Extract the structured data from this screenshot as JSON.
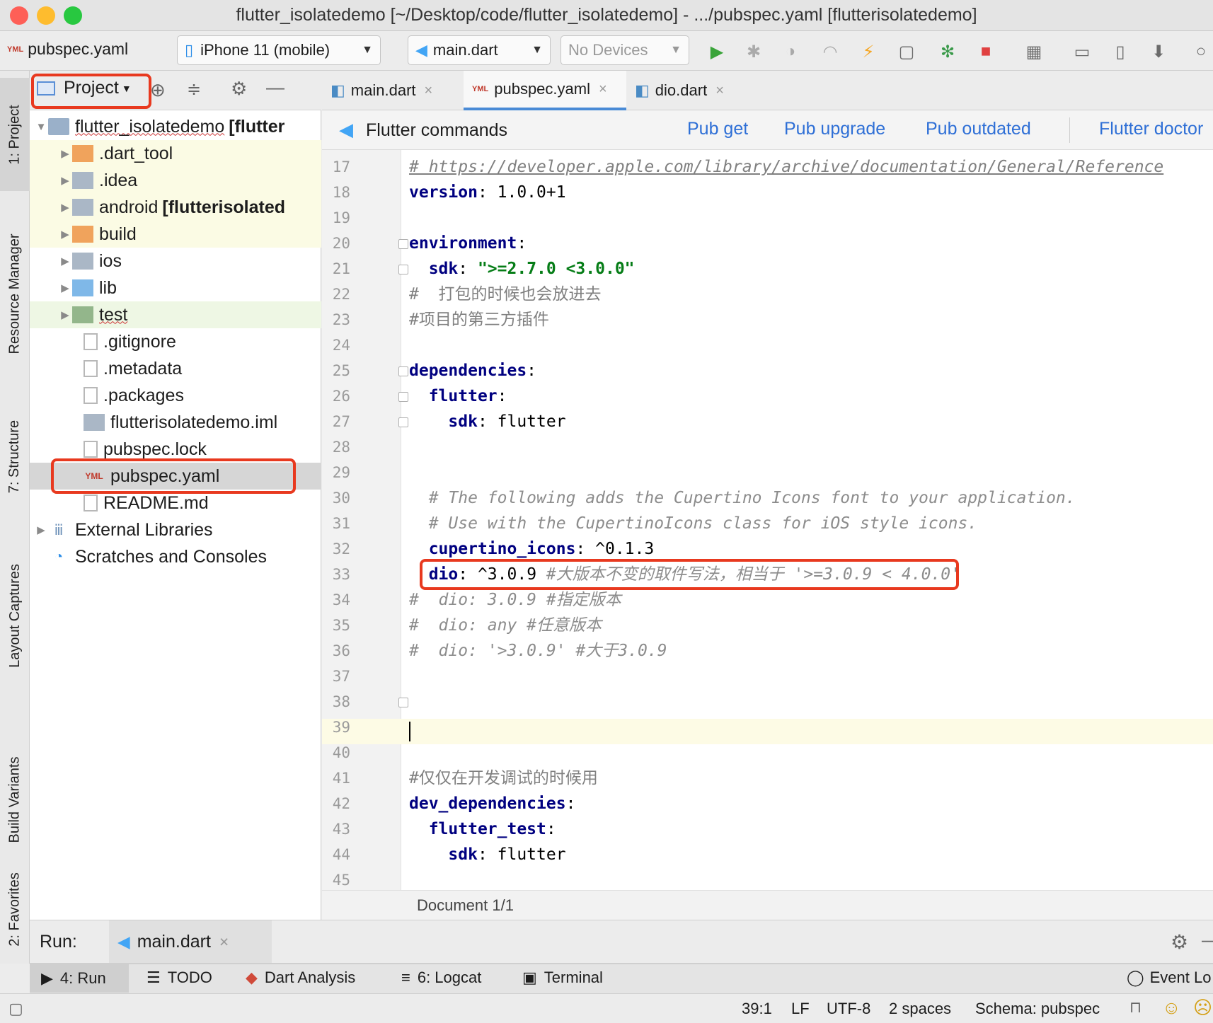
{
  "window": {
    "title": "flutter_isolatedemo [~/Desktop/code/flutter_isolatedemo] - .../pubspec.yaml [flutterisolatedemo]",
    "traffic_colors": [
      "#fe5f57",
      "#febc2e",
      "#28c840"
    ]
  },
  "toolbar": {
    "file_label": "pubspec.yaml",
    "device_select": "iPhone 11 (mobile)",
    "config_select": "main.dart",
    "devices_select": "No Devices"
  },
  "left_strip": {
    "tabs": [
      "1: Project",
      "Resource Manager",
      "7: Structure",
      "Layout Captures",
      "Build Variants",
      "2: Favorites"
    ]
  },
  "project": {
    "view_label": "Project",
    "root": {
      "name": "flutter_isolatedemo",
      "module": "[flutter"
    },
    "items": [
      {
        "label": "dart_tool_label",
        "text": ".dart_tool"
      },
      {
        "text": ".idea"
      },
      {
        "text": "android",
        "module": "[flutterisolated"
      },
      {
        "text": "build"
      },
      {
        "text": "ios"
      },
      {
        "text": "lib"
      },
      {
        "text": "test"
      },
      {
        "text": ".gitignore"
      },
      {
        "text": ".metadata"
      },
      {
        "text": ".packages"
      },
      {
        "text": "flutterisolatedemo.iml"
      },
      {
        "text": "pubspec.lock"
      },
      {
        "text": "pubspec.yaml"
      },
      {
        "text": "README.md"
      }
    ],
    "external_libraries": "External Libraries",
    "scratches": "Scratches and Consoles"
  },
  "editor": {
    "tabs": [
      {
        "label": "main.dart",
        "close": "×"
      },
      {
        "label": "pubspec.yaml",
        "close": "×"
      },
      {
        "label": "dio.dart",
        "close": "×"
      }
    ],
    "flutter_bar": {
      "title": "Flutter commands",
      "commands": [
        "Pub get",
        "Pub upgrade",
        "Pub outdated",
        "Flutter doctor"
      ]
    },
    "line_numbers": [
      "17",
      "18",
      "19",
      "20",
      "21",
      "22",
      "23",
      "24",
      "25",
      "26",
      "27",
      "28",
      "29",
      "30",
      "31",
      "32",
      "33",
      "34",
      "35",
      "36",
      "37",
      "38",
      "39",
      "40",
      "41",
      "42",
      "43",
      "44",
      "45"
    ],
    "code": {
      "l17_comment": "# https://developer.apple.com/library/archive/documentation/General/Reference",
      "l18_key": "version",
      "l18_val": " 1.0.0+1",
      "l20_key": "environment",
      "l21_key": "sdk",
      "l21_val": "\">=2.7.0 <3.0.0\"",
      "l22": "#  打包的时候也会放进去",
      "l23": "#项目的第三方插件",
      "l25_key": "dependencies",
      "l26_key": "flutter",
      "l27_key": "sdk",
      "l27_val": " flutter",
      "l30": "# The following adds the Cupertino Icons font to your application.",
      "l31": "# Use with the CupertinoIcons class for iOS style icons.",
      "l32_key": "cupertino_icons",
      "l32_val": " ^0.1.3",
      "l33_key": "dio",
      "l33_val": " ^3.0.9 ",
      "l33_comment": "#大版本不变的取件写法，相当于 '>=3.0.9 < 4.0.0'",
      "l34": "#  dio: 3.0.9 #指定版本",
      "l35": "#  dio: any #任意版本",
      "l36": "#  dio: '>3.0.9' #大于3.0.9",
      "l41": "#仅仅在开发调试的时候用",
      "l42_key": "dev_dependencies",
      "l43_key": "flutter_test",
      "l44_key": "sdk",
      "l44_val": " flutter"
    },
    "doc_status": "Document 1/1"
  },
  "run_bar": {
    "label": "Run:",
    "config": "main.dart",
    "close": "×"
  },
  "tool_tabs": [
    "4: Run",
    "TODO",
    "Dart Analysis",
    "6: Logcat",
    "Terminal",
    "Event Lo"
  ],
  "status": {
    "position": "39:1",
    "line_sep": "LF",
    "encoding": "UTF-8",
    "indent": "2 spaces",
    "schema": "Schema: pubspec"
  }
}
